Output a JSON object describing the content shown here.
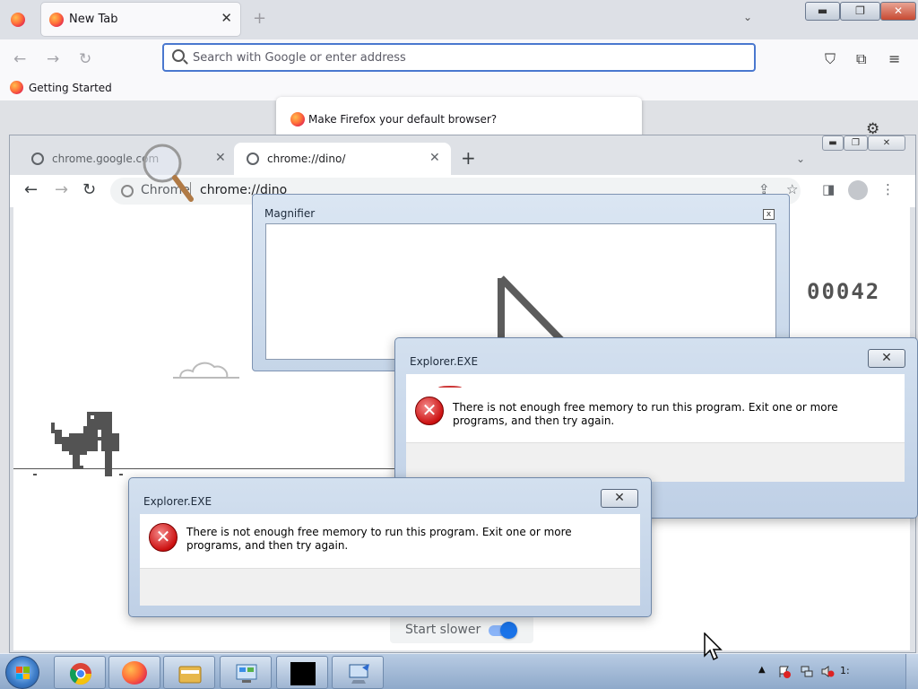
{
  "firefox": {
    "tab_title": "New Tab",
    "tab_close": "✕",
    "new_tab": "+",
    "tab_list": "⌄",
    "caption": {
      "minimize": "▬",
      "maximize": "❐",
      "close": "✕"
    },
    "nav": {
      "back": "←",
      "forward": "→",
      "reload": "↻"
    },
    "url_placeholder": "Search with Google or enter address",
    "toolbar_icons": [
      "pocket-icon",
      "extensions-icon",
      "menu-icon"
    ],
    "toolbar_glyphs": {
      "pocket": "⛉",
      "extensions": "⧉",
      "menu": "≡"
    },
    "bookmark_label": "Getting Started",
    "default_browser_prompt": "Make Firefox your default browser?",
    "settings_glyph": "⚙"
  },
  "chrome": {
    "caption": {
      "minimize": "▬",
      "maximize": "❐",
      "close": "✕"
    },
    "tabs": [
      {
        "title": "chrome.google.com",
        "close": "✕"
      },
      {
        "title": "chrome://dino/",
        "close": "✕"
      }
    ],
    "new_tab": "+",
    "tab_search": "⌄",
    "nav": {
      "back": "←",
      "forward": "→",
      "reload": "↻"
    },
    "omnibox_label": "Chrome",
    "omnibox_url": "chrome://dino",
    "toolbar_glyphs": {
      "share": "⇪",
      "bookmark": "☆",
      "side_panel": "◨",
      "menu": "⋮"
    }
  },
  "dino_game": {
    "score": "00042",
    "start_slower_label": "Start slower",
    "start_slower_enabled": true
  },
  "magnifier": {
    "title": "Magnifier",
    "close": "x"
  },
  "dialogs": [
    {
      "title": "Explorer.EXE",
      "message": "There is not enough free memory to run this program. Exit one or more programs, and then try again.",
      "icon": "error-icon",
      "close": "✕"
    },
    {
      "title": "Explorer.EXE",
      "message": "There is not enough free memory to run this program. Exit one or more programs, and then try again.",
      "icon": "error-icon",
      "close": "✕"
    }
  ],
  "taskbar": {
    "pinned": [
      "chrome-icon",
      "firefox-icon",
      "file-explorer-icon",
      "control-panel-icon",
      "black-window-icon",
      "remote-desktop-icon"
    ],
    "tray_arrow": "▲",
    "tray_icons": [
      "action-center-icon",
      "network-icon",
      "volume-muted-icon"
    ],
    "clock": "1:"
  },
  "colors": {
    "chrome_accent": "#1a73e8",
    "firefox_url_focus": "#4a78cf",
    "error_red": "#cc1111",
    "dino_gray": "#535353"
  }
}
